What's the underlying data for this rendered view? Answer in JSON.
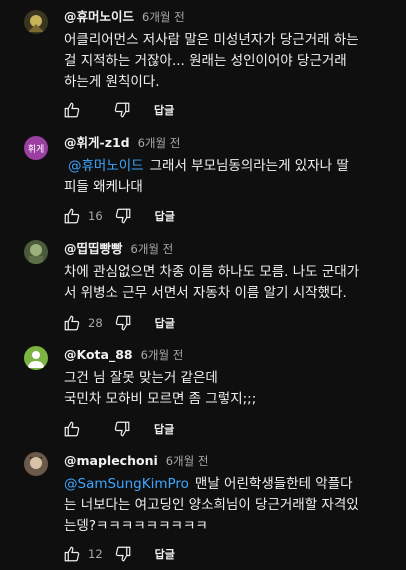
{
  "comments": [
    {
      "author": "@휴머노이드",
      "time": "6개월 전",
      "avatar": {
        "type": "image",
        "colors": [
          "#3a3420",
          "#c8b25a"
        ]
      },
      "mention": "",
      "lines": [
        "어클리어먼스 저사람 말은 미성년자가 당근거래 하는",
        "걸 지적하는 거잖아... 원래는 성인이어야 당근거래",
        "하는게 원칙이다."
      ],
      "likes": "",
      "reply_label": "답글"
    },
    {
      "author": "@휘게-z1d",
      "time": "6개월 전",
      "avatar": {
        "type": "text",
        "text": "휘게",
        "bg": "#9c3fa3"
      },
      "mention": "@휴머노이드",
      "lines": [
        "그래서 부모님동의라는게 있자나 딸",
        "피들 왜케나대"
      ],
      "likes": "16",
      "reply_label": "답글"
    },
    {
      "author": "@띱띱빵빵",
      "time": "6개월 전",
      "avatar": {
        "type": "image",
        "colors": [
          "#4a5a3a",
          "#9bb07a"
        ]
      },
      "mention": "",
      "lines": [
        "차에 관심없으면 차종 이름 하나도 모름. 나도 군대가",
        "서 위병소 근무 서면서 자동차 이름 알기 시작했다."
      ],
      "likes": "28",
      "reply_label": "답글"
    },
    {
      "author": "@Kota_88",
      "time": "6개월 전",
      "avatar": {
        "type": "person",
        "bg": "#7cb342"
      },
      "mention": "",
      "lines": [
        "그건 님 잘못 맞는거 같은데",
        "국민차 모하비 모르면 좀 그렇지;;;"
      ],
      "likes": "",
      "reply_label": "답글"
    },
    {
      "author": "@maplechoni",
      "time": "6개월 전",
      "avatar": {
        "type": "image",
        "colors": [
          "#6b5a4a",
          "#d9c2a8"
        ]
      },
      "mention": "@SamSungKimPro",
      "lines": [
        "맨날 어린학생들한테 악플다",
        "는 너보다는 여고딩인 양소희님이 당근거래할 자격있",
        "는뎅?ㅋㅋㅋㅋㅋㅋㅋㅋㅋ"
      ],
      "likes": "12",
      "reply_label": "답글"
    }
  ]
}
